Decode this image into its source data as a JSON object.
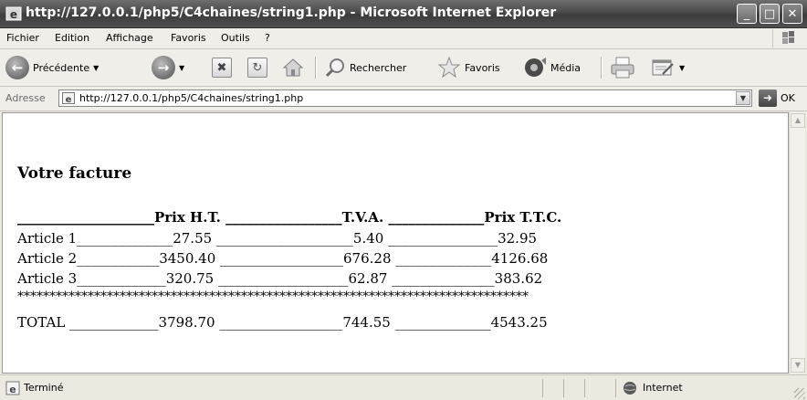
{
  "window": {
    "title": "http://127.0.0.1/php5/C4chaines/string1.php - Microsoft Internet Explorer",
    "minimize_glyph": "_",
    "maximize_glyph": "□",
    "close_glyph": "✕"
  },
  "menubar": {
    "items": [
      "Fichier",
      "Edition",
      "Affichage",
      "Favoris",
      "Outils",
      "?"
    ]
  },
  "toolbar": {
    "back_label": "Précédente",
    "search_label": "Rechercher",
    "favorites_label": "Favoris",
    "media_label": "Média"
  },
  "address": {
    "label": "Adresse",
    "url": "http://127.0.0.1/php5/C4chaines/string1.php",
    "go_label": "OK"
  },
  "page": {
    "heading": "Votre facture",
    "header_line": "____________________Prix H.T. _________________T.V.A. ______________Prix T.T.C.",
    "rows": [
      "Article 1______________27.55 ____________________5.40 ________________32.95",
      "Article 2____________3450.40 __________________676.28 ______________4126.68",
      "Article 3_____________320.75 ___________________62.87 _______________383.62"
    ],
    "stars": "********************************************************************************",
    "total_line": "TOTAL _____________3798.70 __________________744.55 ______________4543.25"
  },
  "status": {
    "text": "Terminé",
    "zone": "Internet"
  },
  "colors": {
    "titlebar": "#4a4a4a",
    "chrome": "#efeee9",
    "content_bg": "#ffffff"
  }
}
